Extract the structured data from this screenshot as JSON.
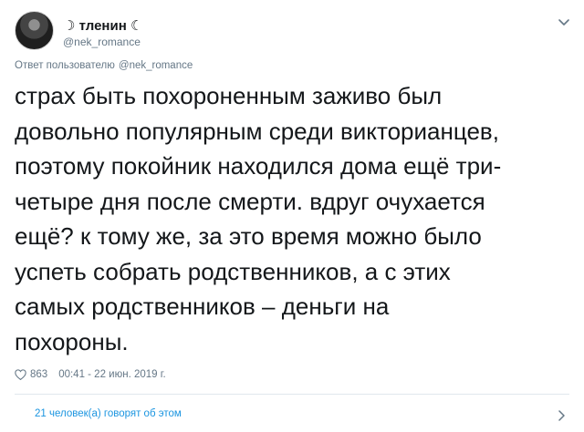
{
  "author": {
    "display_name": "☽ тленин ☾",
    "handle": "@nek_romance"
  },
  "reply_to": {
    "prefix": "Ответ пользователю",
    "handle": "@nek_romance"
  },
  "tweet": {
    "text_lines": [
      "страх быть похороненным заживо был",
      "довольно популярным среди викторианцев,",
      "поэтому покойник находился дома ещё три-",
      "четыре дня после смерти. вдруг очухается",
      "ещё? к тому же, за это время можно было",
      "успеть собрать родственников, а с этих",
      "самых родственников – деньги на",
      "похороны."
    ]
  },
  "meta": {
    "likes": "863",
    "timestamp": "00:41 - 22 июн. 2019 г."
  },
  "conversation": {
    "label": "21 человек(а) говорят об этом"
  },
  "colors": {
    "text": "#14171a",
    "secondary": "#657786",
    "link": "#1b95e0",
    "divider": "#e1e8ed"
  },
  "icons": {
    "avatar": "avatar",
    "more": "chevron-down-icon",
    "like": "heart-icon",
    "open": "chevron-right-icon"
  }
}
